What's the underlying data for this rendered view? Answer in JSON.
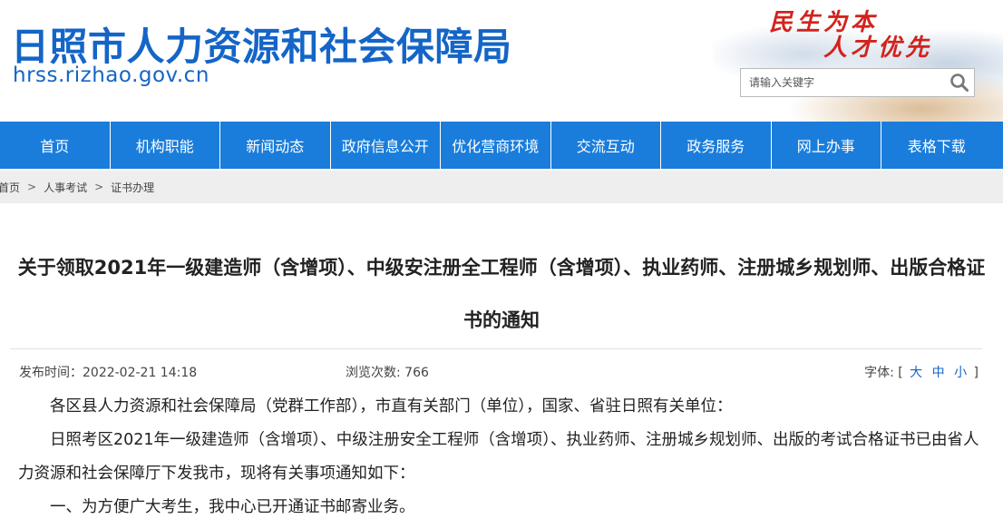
{
  "header": {
    "title": "日照市人力资源和社会保障局",
    "url": "hrss.rizhao.gov.cn",
    "slogan_line1": "民生为本",
    "slogan_line2": "人才优先",
    "search": {
      "placeholder": "请输入关键字",
      "value": "",
      "icon": "search-icon"
    }
  },
  "nav": {
    "items": [
      {
        "label": "首页"
      },
      {
        "label": "机构职能"
      },
      {
        "label": "新闻动态"
      },
      {
        "label": "政府信息公开"
      },
      {
        "label": "优化营商环境"
      },
      {
        "label": "交流互动"
      },
      {
        "label": "政务服务"
      },
      {
        "label": "网上办事"
      },
      {
        "label": "表格下载"
      }
    ]
  },
  "breadcrumb": {
    "items": [
      "首页",
      "人事考试",
      "证书办理"
    ],
    "separator": ">"
  },
  "article": {
    "title": "关于领取2021年一级建造师（含增项）、中级安注册全工程师（含增项）、执业药师、注册城乡规划师、出版合格证书的通知",
    "meta": {
      "date_label": "发布时间：2022-02-21 14:18",
      "views_label": "浏览次数: 766",
      "font_label": "字体:",
      "bracket_open": "[",
      "bracket_close": "]",
      "font_sizes": [
        "大",
        "中",
        "小"
      ]
    },
    "paragraphs": [
      "各区县人力资源和社会保障局（党群工作部），市直有关部门（单位），国家、省驻日照有关单位：",
      "日照考区2021年一级建造师（含增项）、中级注册安全工程师（含增项）、执业药师、注册城乡规划师、出版的考试合格证书已由省人力资源和社会保障厅下发我市，现将有关事项通知如下：",
      "一、为方便广大考生，我中心已开通证书邮寄业务。"
    ]
  },
  "colors": {
    "brand_blue": "#1465c7",
    "nav_blue": "#1a7ddb",
    "slogan_red": "#d2231c",
    "breadcrumb_bg": "#eeeeee"
  }
}
